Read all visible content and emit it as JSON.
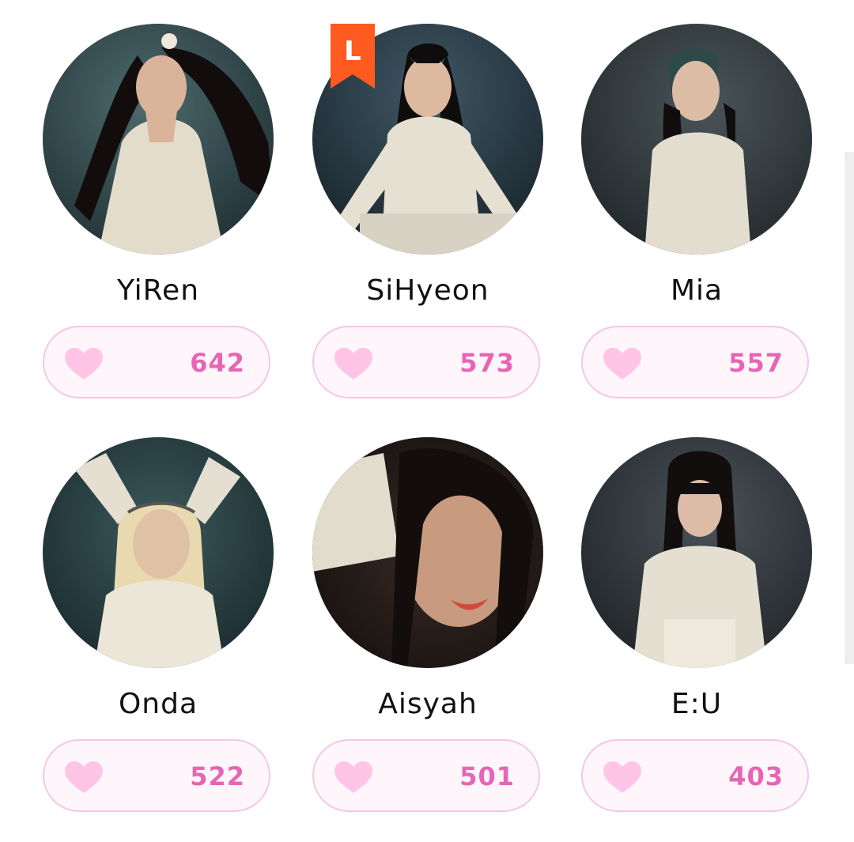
{
  "members": [
    {
      "name": "YiRen",
      "votes": "642"
    },
    {
      "name": "SiHyeon",
      "votes": "573"
    },
    {
      "name": "Mia",
      "votes": "557"
    },
    {
      "name": "Onda",
      "votes": "522"
    },
    {
      "name": "Aisyah",
      "votes": "501"
    },
    {
      "name": "E:U",
      "votes": "403"
    }
  ],
  "leader_badge": {
    "letter": "L",
    "color": "#ff5a1f"
  },
  "colors": {
    "accent": "#e765b4",
    "heart": "#ffc4e6",
    "pill_border": "#f4c7e4",
    "pill_bg": "#fff6fb"
  },
  "icons": {
    "vote": "heart-icon",
    "badge": "leader-bookmark-icon"
  }
}
